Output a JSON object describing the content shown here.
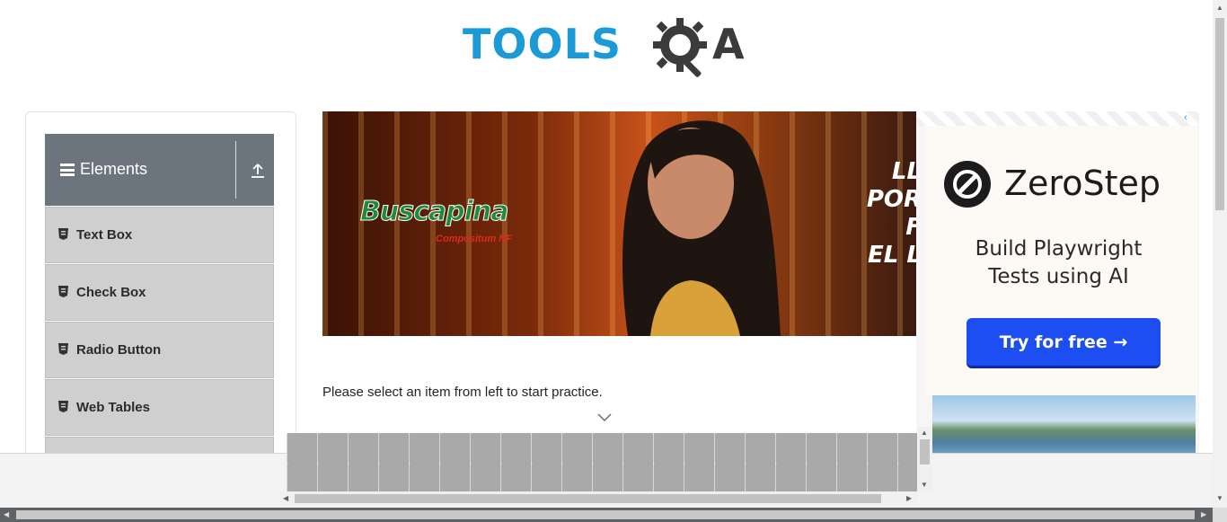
{
  "header": {
    "logo_text": "TOOLS",
    "logo_suffix": "A"
  },
  "sidebar": {
    "group": {
      "title": "Elements"
    },
    "items": [
      {
        "label": "Text Box"
      },
      {
        "label": "Check Box"
      },
      {
        "label": "Radio Button"
      },
      {
        "label": "Web Tables"
      },
      {
        "label": ""
      }
    ]
  },
  "main_ad": {
    "brand": "Buscapina",
    "brand_sub": "Compositum NF",
    "headline": [
      "LL",
      "POR",
      "F",
      "EL L"
    ]
  },
  "side_ad": {
    "adchoice": "‹",
    "brand": "ZeroStep",
    "tagline_line1": "Build Playwright",
    "tagline_line2": "Tests using AI",
    "cta": "Try for free →"
  },
  "main": {
    "instruction": "Please select an item from left to start practice."
  },
  "colors": {
    "brand_blue": "#1b9ad8",
    "sidebar_header": "#6c757d",
    "menu_item_bg": "#cfcfcf",
    "cta_blue": "#1d4ef2"
  }
}
